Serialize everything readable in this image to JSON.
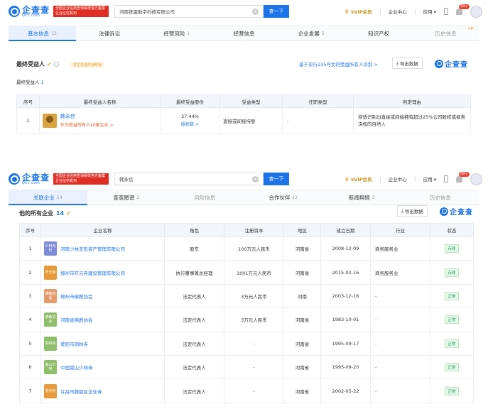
{
  "brand": {
    "name_cn": "企查查",
    "name_en": "Qcc.com",
    "cert": "全国企业信用查询系统官方备案企业征信机构"
  },
  "header": {
    "svip": "SVIP会员",
    "enterprise_center": "企业中心",
    "apps": "应用 ▾",
    "msg_badge": "99+"
  },
  "panel1": {
    "search_value": "河南铁蛋数字科技有限公司",
    "search_button": "查一下",
    "tabs": [
      {
        "label": "基本信息",
        "count": "13",
        "state": "active"
      },
      {
        "label": "法律诉讼",
        "count": "",
        "state": "normal"
      },
      {
        "label": "经营风险",
        "count": "1",
        "state": "normal"
      },
      {
        "label": "经营信息",
        "count": "",
        "state": "normal"
      },
      {
        "label": "企业发展",
        "count": "5",
        "state": "normal"
      },
      {
        "label": "知识产权",
        "count": "",
        "state": "normal"
      },
      {
        "label": "历史信息",
        "count": "",
        "state": "disabled",
        "tag": "VIP"
      }
    ],
    "section_title": "最终受益人",
    "warn_tag": "发生变更时通知我",
    "rule_link": "基于央行235号文的受益所有人识别 >",
    "export_button": "导出数据",
    "sub_label": "最终受益人",
    "sub_count": "1",
    "table": {
      "headers": [
        "序号",
        "最终受益人名称",
        "最终受益股份",
        "受益类型",
        "任职类型",
        "判定理由"
      ],
      "rows": [
        {
          "no": "1",
          "name": "韩永信",
          "sub": "作为受益所有人20家企业 >",
          "share": "27.44%",
          "chain": "股权链 >",
          "type": "直接或间接持股",
          "position": "-",
          "reason": "穿透识别出直接或间接拥有超过25%公司股权或者表决权的自然人"
        }
      ]
    }
  },
  "panel2": {
    "search_value": "韩永信",
    "search_button": "查一下",
    "tabs": [
      {
        "label": "关联企业",
        "count": "14",
        "state": "active"
      },
      {
        "label": "查查图谱",
        "count": "2",
        "state": "normal"
      },
      {
        "label": "风险信息",
        "count": "",
        "state": "disabled"
      },
      {
        "label": "合作伙伴",
        "count": "12",
        "state": "normal"
      },
      {
        "label": "新闻舆情",
        "count": "2",
        "state": "normal"
      },
      {
        "label": "历史信息",
        "count": "",
        "state": "disabled"
      }
    ],
    "section_title": "他的所有企业",
    "section_count": "14",
    "export_button": "导出数据",
    "table": {
      "headers": [
        "序号",
        "企业名称",
        "角色",
        "注册资本",
        "地区",
        "成立日期",
        "行业",
        "状态"
      ],
      "rows": [
        {
          "no": "1",
          "logo": "少林无形",
          "logo_color": "#7e8bd6",
          "name": "河南少林无形资产管理有限公司",
          "role": "股东",
          "capital": "100万元人民币",
          "region": "河南省",
          "date": "2008-12-09",
          "industry": "商务服务业",
          "status": "存续"
        },
        {
          "no": "2",
          "logo": "开元寺",
          "logo_color": "#e69a3c",
          "name": "郑州市开元寺建设管理有限公司",
          "role": "执行董事兼总经理",
          "capital": "1001万元人民币",
          "region": "河南省",
          "date": "2015-02-16",
          "industry": "商务服务业",
          "status": "存续"
        },
        {
          "no": "3",
          "logo": "佛教协会",
          "logo_color": "#e39b6b",
          "name": "郑州市佛教协会",
          "role": "法定代表人",
          "capital": "3万元人民币",
          "region": "河南",
          "date": "2003-12-16",
          "industry": "-",
          "status": "正常"
        },
        {
          "no": "4",
          "logo": "佛教协会",
          "logo_color": "#8fbf6a",
          "name": "河南省佛教协会",
          "role": "法定代表人",
          "capital": "3万元人民币",
          "region": "河南省",
          "date": "1983-10-01",
          "industry": "-",
          "status": "正常"
        },
        {
          "no": "5",
          "logo": "洞林寺",
          "logo_color": "#8fbf6a",
          "name": "荥阳市洞林寺",
          "role": "法定代表人",
          "capital": "-",
          "region": "河南省",
          "date": "1995-09-17",
          "industry": "-",
          "status": "正常"
        },
        {
          "no": "6",
          "logo": "嵩山少林",
          "logo_color": "#8fbf6a",
          "name": "中国嵩山少林寺",
          "role": "法定代表人",
          "capital": "-",
          "region": "河南省",
          "date": "1995-09-20",
          "industry": "-",
          "status": "正常"
        },
        {
          "no": "7",
          "logo": "龙化寺",
          "logo_color": "#e69a3c",
          "name": "许昌市魏都区龙化寺",
          "role": "法定代表人",
          "capital": "-",
          "region": "河南省",
          "date": "2002-05-22",
          "industry": "-",
          "status": "正常"
        }
      ]
    }
  }
}
